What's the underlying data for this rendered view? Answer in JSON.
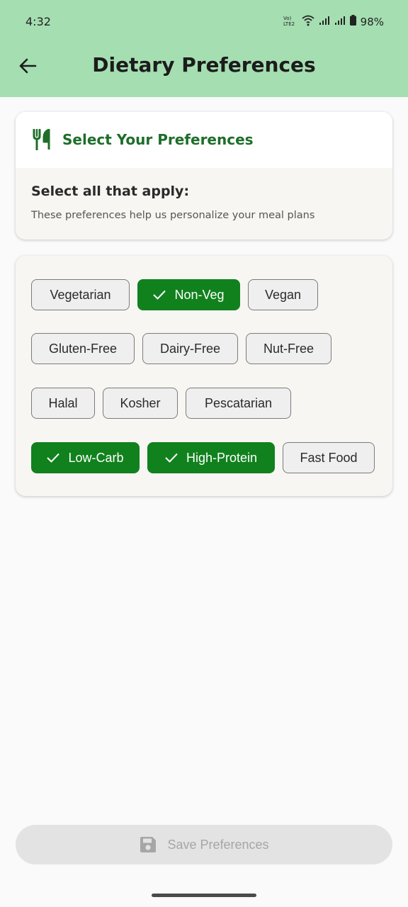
{
  "status_bar": {
    "time": "4:32",
    "network_label": "Vo) LTE2",
    "battery": "98%"
  },
  "appbar": {
    "title": "Dietary Preferences",
    "back_icon": "arrow-back-icon",
    "background": "#a5deb1"
  },
  "header_card": {
    "icon": "restaurant-icon",
    "title": "Select Your Preferences",
    "subtitle": "Select all that apply:",
    "description": "These preferences help us personalize your meal plans"
  },
  "preferences": [
    {
      "label": "Vegetarian",
      "selected": false
    },
    {
      "label": "Non-Veg",
      "selected": true
    },
    {
      "label": "Vegan",
      "selected": false
    },
    {
      "label": "Gluten-Free",
      "selected": false
    },
    {
      "label": "Dairy-Free",
      "selected": false
    },
    {
      "label": "Nut-Free",
      "selected": false
    },
    {
      "label": "Halal",
      "selected": false
    },
    {
      "label": "Kosher",
      "selected": false
    },
    {
      "label": "Pescatarian",
      "selected": false
    },
    {
      "label": "Low-Carb",
      "selected": true
    },
    {
      "label": "High-Protein",
      "selected": true
    },
    {
      "label": "Fast Food",
      "selected": false
    }
  ],
  "save_button": {
    "label": "Save Preferences",
    "icon": "save-icon",
    "enabled": false
  },
  "colors": {
    "accent": "#11811e",
    "title_green": "#1e6e2a"
  }
}
